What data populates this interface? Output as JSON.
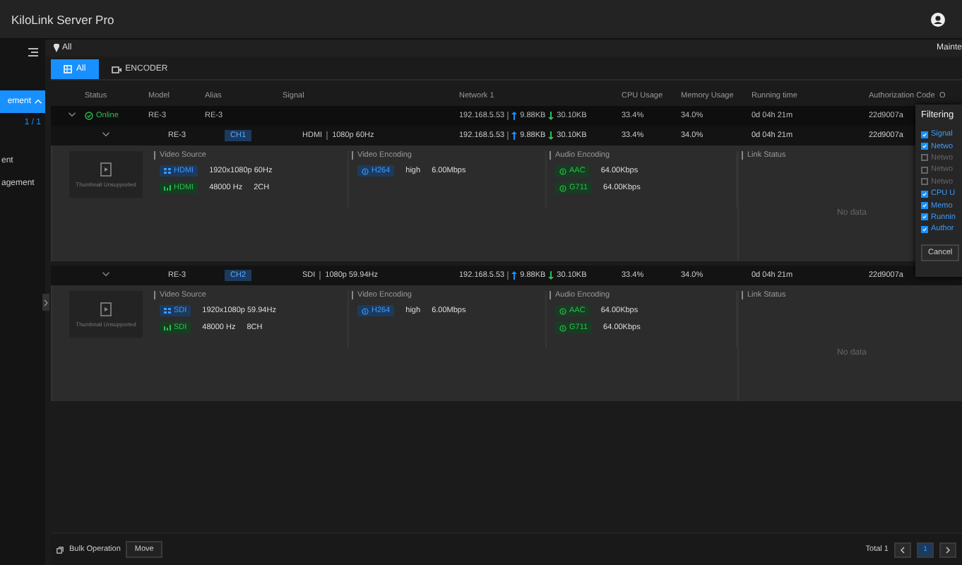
{
  "window": {
    "title": "KiloLink Server Pro"
  },
  "sidebar": {
    "items": [
      {
        "label": "ement",
        "selected": true,
        "expanded": true,
        "count": "1 / 1"
      },
      {
        "label": "ent",
        "selected": false
      },
      {
        "label": "agement",
        "selected": false
      }
    ]
  },
  "location": {
    "label": "All",
    "right_label": "Mainte"
  },
  "tabs": [
    {
      "label": "All",
      "selected": true,
      "kind": "table"
    },
    {
      "label": "ENCODER",
      "selected": false,
      "kind": "camera"
    }
  ],
  "table": {
    "columns": [
      "Status",
      "Model",
      "Alias",
      "Signal",
      "Network 1",
      "CPU Usage",
      "Memory Usage",
      "Running time",
      "Authorization Code",
      "O"
    ],
    "rows": [
      {
        "status": "Online",
        "model": "RE-3",
        "alias": "RE-3",
        "ip": "192.168.5.53",
        "up": "9.88KB",
        "down": "30.10KB",
        "cpu": "33.4%",
        "memory": "34.0%",
        "running": "0d 04h 21m",
        "auth": "22d9007a",
        "expanded": true,
        "channels": [
          {
            "model": "RE-3",
            "channel": "CH1",
            "signal_type": "HDMI",
            "signal": "1080p 60Hz",
            "ip": "192.168.5.53",
            "up": "9.88KB",
            "down": "30.10KB",
            "cpu": "33.4%",
            "memory": "34.0%",
            "running": "0d 04h 21m",
            "auth": "22d9007a",
            "expanded": true,
            "detail": {
              "thumbnail": "Thumbnail Unsupported",
              "video_source": {
                "title": "Video Source",
                "video_label": "HDMI",
                "video_values": [
                  "1920x1080p 60Hz"
                ],
                "audio_label": "HDMI",
                "audio_values": [
                  "48000 Hz",
                  "2CH"
                ]
              },
              "video_encoding": {
                "title": "Video Encoding",
                "items": [
                  {
                    "codec": "H264",
                    "values": [
                      "high",
                      "6.00Mbps"
                    ]
                  }
                ]
              },
              "audio_encoding": {
                "title": "Audio Encoding",
                "items": [
                  {
                    "codec": "AAC",
                    "values": [
                      "64.00Kbps"
                    ]
                  },
                  {
                    "codec": "G711",
                    "values": [
                      "64.00Kbps"
                    ]
                  }
                ]
              },
              "link_status": {
                "title": "Link Status",
                "empty": "No data"
              }
            }
          },
          {
            "model": "RE-3",
            "channel": "CH2",
            "signal_type": "SDI",
            "signal": "1080p 59.94Hz",
            "ip": "192.168.5.53",
            "up": "9.88KB",
            "down": "30.10KB",
            "cpu": "33.4%",
            "memory": "34.0%",
            "running": "0d 04h 21m",
            "auth": "22d9007a",
            "expanded": true,
            "detail": {
              "thumbnail": "Thumbnail Unsupported",
              "video_source": {
                "title": "Video Source",
                "video_label": "SDI",
                "video_values": [
                  "1920x1080p 59.94Hz"
                ],
                "audio_label": "SDI",
                "audio_values": [
                  "48000 Hz",
                  "8CH"
                ]
              },
              "video_encoding": {
                "title": "Video Encoding",
                "items": [
                  {
                    "codec": "H264",
                    "values": [
                      "high",
                      "6.00Mbps"
                    ]
                  }
                ]
              },
              "audio_encoding": {
                "title": "Audio Encoding",
                "items": [
                  {
                    "codec": "AAC",
                    "values": [
                      "64.00Kbps"
                    ]
                  },
                  {
                    "codec": "G711",
                    "values": [
                      "64.00Kbps"
                    ]
                  }
                ]
              },
              "link_status": {
                "title": "Link Status",
                "empty": "No data"
              }
            }
          }
        ]
      }
    ]
  },
  "filter": {
    "title": "Filtering",
    "options": [
      {
        "label": "Signal",
        "checked": true
      },
      {
        "label": "Netwo",
        "checked": true
      },
      {
        "label": "Netwo",
        "checked": false
      },
      {
        "label": "Netwo",
        "checked": false
      },
      {
        "label": "Netwo",
        "checked": false
      },
      {
        "label": "CPU U",
        "checked": true
      },
      {
        "label": "Memo",
        "checked": true
      },
      {
        "label": "Runnin",
        "checked": true
      },
      {
        "label": "Author",
        "checked": true
      }
    ],
    "cancel": "Cancel"
  },
  "footer": {
    "bulk": "Bulk Operation",
    "move": "Move",
    "total": "Total 1",
    "pages": [
      {
        "label": "1",
        "selected": true
      }
    ]
  }
}
